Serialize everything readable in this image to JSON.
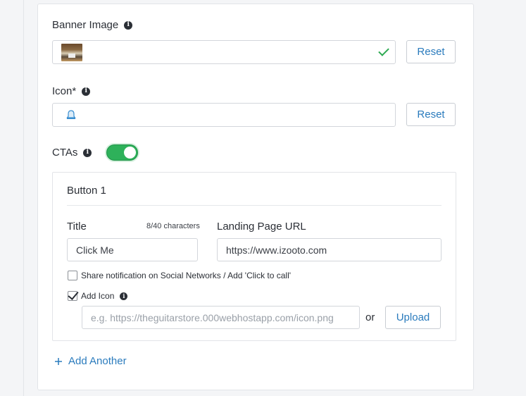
{
  "banner": {
    "label": "Banner Image",
    "reset_label": "Reset"
  },
  "icon_field": {
    "label": "Icon*",
    "reset_label": "Reset"
  },
  "ctas": {
    "label": "CTAs",
    "enabled": true,
    "toggle_color": "#2eb15a"
  },
  "button1": {
    "heading": "Button 1",
    "title_label": "Title",
    "char_count": "8/40 characters",
    "title_value": "Click Me",
    "url_label": "Landing Page URL",
    "url_value": "https://www.izooto.com",
    "share_label": "Share notification on Social Networks / Add 'Click to call'",
    "share_checked": false,
    "add_icon_label": "Add Icon",
    "add_icon_checked": true,
    "icon_url_placeholder": "e.g. https://theguitarstore.000webhostapp.com/icon.png",
    "or_label": "or",
    "upload_label": "Upload"
  },
  "add_another_label": "Add Another",
  "colors": {
    "link": "#2a7bbd",
    "success": "#2eaa52"
  }
}
